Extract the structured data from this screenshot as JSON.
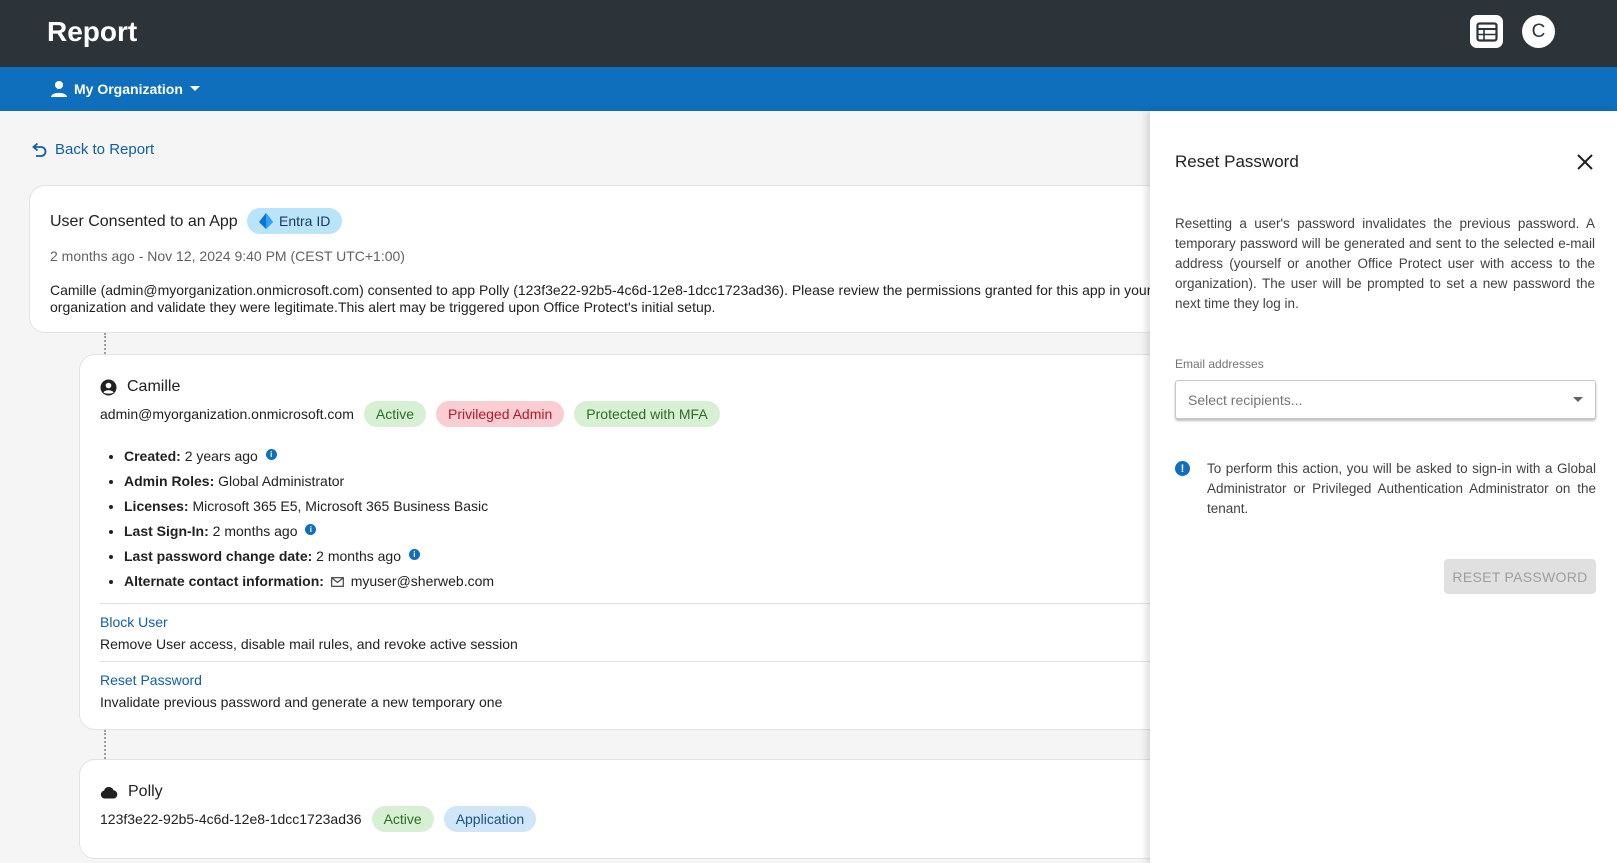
{
  "header": {
    "title": "Report",
    "avatar_initial": "C",
    "icons": [
      "report-table-icon"
    ]
  },
  "org_bar": {
    "org_name": "My Organization",
    "icons": [
      "person-icon",
      "caret-down-icon"
    ]
  },
  "back_link": {
    "label": "Back to Report",
    "icon": "undo-arrow-icon"
  },
  "alert": {
    "title": "User Consented to an App",
    "source_chip": "Entra ID",
    "timestamp": "2 months ago - Nov 12, 2024 9:40 PM (CEST UTC+1:00)",
    "description": "Camille (admin@myorganization.onmicrosoft.com) consented to app Polly (123f3e22-92b5-4c6d-12e8-1dcc1723ad36). Please review the permissions granted for this app in your organization and validate they were legitimate.This alert may be triggered upon Office Protect's initial setup."
  },
  "user": {
    "name": "Camille",
    "email": "admin@myorganization.onmicrosoft.com",
    "chips": [
      "Active",
      "Privileged Admin",
      "Protected with MFA"
    ],
    "details": [
      {
        "key": "Created:",
        "value": "2 years ago"
      },
      {
        "key": "Admin Roles:",
        "value": "Global Administrator"
      },
      {
        "key": "Licenses:",
        "value": "Microsoft 365 E5, Microsoft 365 Business Basic"
      },
      {
        "key": "Last Sign-In:",
        "value": "2 months ago"
      },
      {
        "key": "Last password change date:",
        "value": "2 months ago"
      },
      {
        "key": "Alternate contact information:",
        "value": "myuser@sherweb.com"
      }
    ],
    "actions": [
      {
        "label": "Block User",
        "description": "Remove User access, disable mail rules, and revoke active session"
      },
      {
        "label": "Reset Password",
        "description": "Invalidate previous password and generate a new temporary one"
      }
    ]
  },
  "app": {
    "name": "Polly",
    "id": "123f3e22-92b5-4c6d-12e8-1dcc1723ad36",
    "chips": [
      "Active",
      "Application"
    ]
  },
  "drawer": {
    "title": "Reset Password",
    "description": "Resetting a user's password invalidates the previous password. A temporary password will be generated and sent to the selected e-mail address (yourself or another Office Protect user with access to the organization). The user will be prompted to set a new password the next time they log in.",
    "email_label": "Email addresses",
    "email_placeholder": "Select recipients...",
    "email_value": "",
    "notice": "To perform this action, you will be asked to sign-in with a Global Administrator or Privileged Authentication Administrator on the tenant.",
    "button_label": "RESET PASSWORD"
  },
  "colors": {
    "topbar": "#2c3439",
    "orgbar": "#0f6fbd",
    "link": "#0f5fa8",
    "chip_green": "#d7efd2",
    "chip_red": "#f9cdd2",
    "chip_blue": "#cfe6f8",
    "chip_entra": "#b9e4fa"
  }
}
